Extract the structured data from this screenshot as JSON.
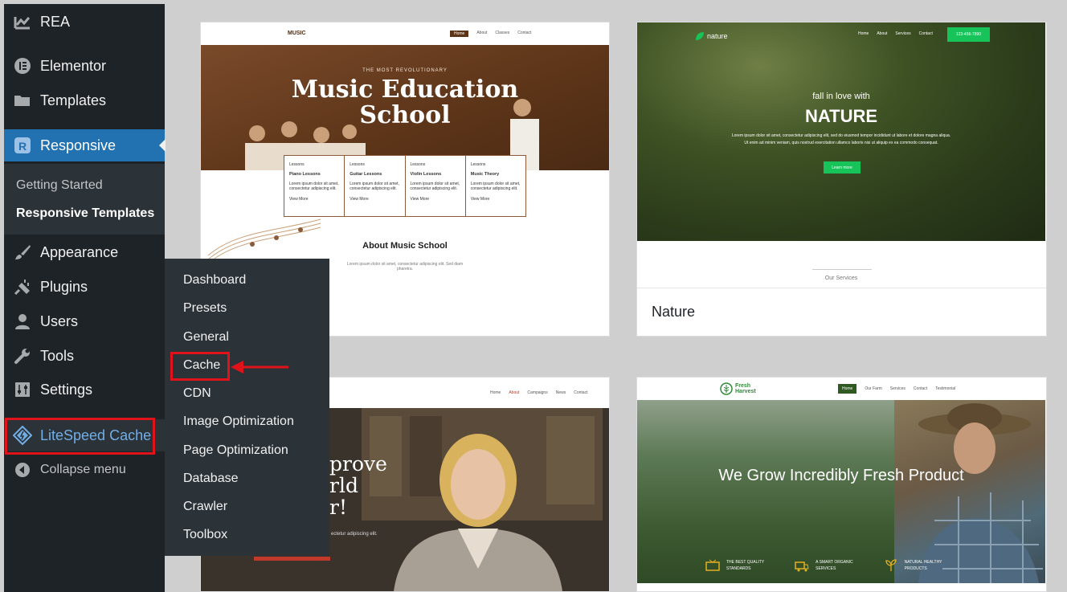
{
  "sidebar": {
    "site_name": "REA",
    "items": [
      {
        "label": "Elementor"
      },
      {
        "label": "Templates"
      },
      {
        "label": "Responsive"
      },
      {
        "label": "Appearance"
      },
      {
        "label": "Plugins"
      },
      {
        "label": "Users"
      },
      {
        "label": "Tools"
      },
      {
        "label": "Settings"
      },
      {
        "label": "LiteSpeed Cache"
      }
    ],
    "responsive_submenu": [
      "Getting Started",
      "Responsive Templates"
    ],
    "collapse_label": "Collapse menu"
  },
  "flyout": {
    "items": [
      "Dashboard",
      "Presets",
      "General",
      "Cache",
      "CDN",
      "Image Optimization",
      "Page Optimization",
      "Database",
      "Crawler",
      "Toolbox"
    ]
  },
  "cards": {
    "music": {
      "logo": "MUSIC",
      "nav": [
        "Home",
        "About",
        "Classes",
        "Contact"
      ],
      "kicker": "THE MOST REVOLUTIONARY",
      "title_line1": "Music Education",
      "title_line2": "School",
      "lessons": [
        {
          "tag": "Lessons",
          "name": "Piano Lessons",
          "link": "View More"
        },
        {
          "tag": "Lessons",
          "name": "Guitar Lessons",
          "link": "View More"
        },
        {
          "tag": "Lessons",
          "name": "Violin Lessons",
          "link": "View More"
        },
        {
          "tag": "Lessons",
          "name": "Music Theory",
          "link": "View More"
        }
      ],
      "lesson_text": "Lorem ipsum dolor sit amet, consectetur adipiscing elit.",
      "about_title": "About Music School",
      "about_text": "Lorem ipsum dolor sit amet, consectetur adipiscing elit. Sed diam pharetra."
    },
    "nature": {
      "logo": "nature",
      "nav": [
        "Home",
        "About",
        "Services",
        "Contact"
      ],
      "cta": "123-456-7890",
      "pre_title": "fall in love with",
      "title": "NATURE",
      "body": "Lorem ipsum dolor sit amet, consectetur adipiscing elit, sed do eiusmod tempor incididunt ut labore et dolore magna aliqua. Ut enim ad minim veniam, quis nostrud exercitation ullamco laboris nisi ut aliquip ex ea commodo consequat.",
      "button": "Learn more",
      "services": "Our Services",
      "label": "Nature"
    },
    "lecture": {
      "nav": [
        "Home",
        "About",
        "Campaigns",
        "News",
        "Contact"
      ],
      "title_fragments": [
        "prove",
        "rld",
        "r!"
      ],
      "subtitle": "ectetur adipiscing elit."
    },
    "harvest": {
      "logo_line1": "Fresh",
      "logo_line2": "Harvest",
      "nav": [
        "Home",
        "Our Farm",
        "Services",
        "Contact",
        "Testimonial"
      ],
      "title": "We Grow Incredibly Fresh Product",
      "features": [
        {
          "line1": "THE BEST QUALITY",
          "line2": "STANDARDS"
        },
        {
          "line1": "A SMART ORGANIC",
          "line2": "SERVICES"
        },
        {
          "line1": "NATURAL HEALTHY",
          "line2": "PRODUCTS"
        }
      ]
    }
  },
  "colors": {
    "admin_sidebar": "#1d2327",
    "admin_accent": "#2271b1",
    "flyout_bg": "#2c3338",
    "highlight_red": "#e0131a",
    "nature_green": "#16c45a",
    "music_brown": "#5c3418"
  }
}
